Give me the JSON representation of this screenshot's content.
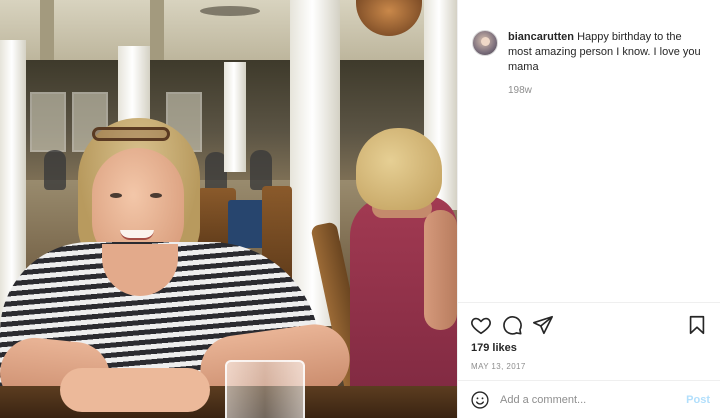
{
  "post": {
    "photo_icon": "restaurant-photo",
    "author": {
      "username": "biancarutten",
      "avatar_icon": "profile-avatar"
    },
    "caption_text": "Happy birthday to the most amazing person I know. I love you mama",
    "relative_time": "198w",
    "actions": {
      "like_icon": "heart-icon",
      "comment_icon": "comment-bubble-icon",
      "share_icon": "paper-plane-icon",
      "save_icon": "bookmark-icon"
    },
    "likes_text": "179 likes",
    "date_text": "MAY 13, 2017"
  },
  "comment_box": {
    "emoji_icon": "smiley-icon",
    "placeholder": "Add a comment...",
    "post_label": "Post"
  },
  "colors": {
    "text": "#262626",
    "muted": "#8e8e8e",
    "post_disabled": "#b2dffc",
    "divider": "#efefef"
  }
}
